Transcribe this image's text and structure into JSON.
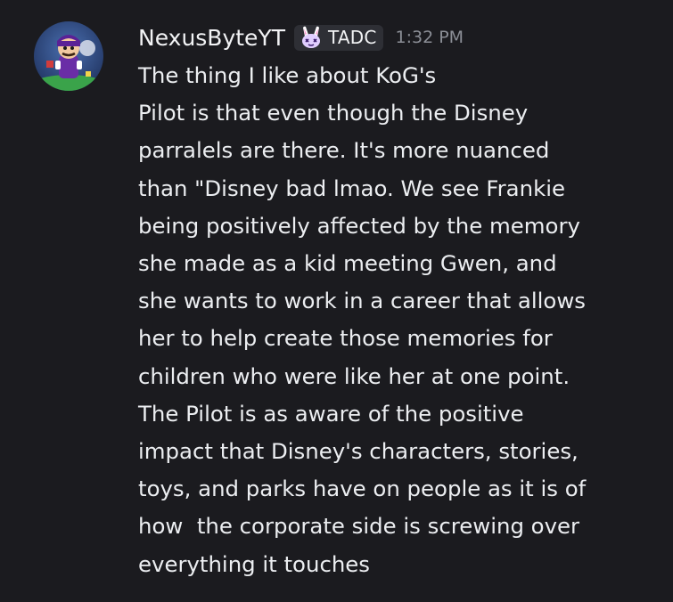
{
  "message": {
    "author": {
      "name": "NexusByteYT",
      "avatar_icon": "purple-character-avatar-icon"
    },
    "tag": {
      "icon": "bunny-icon",
      "label": "TADC",
      "icon_color": "#c9a6ff"
    },
    "timestamp": "1:32 PM",
    "lines": [
      "The thing I like about KoG's",
      "Pilot is that even though the Disney",
      "parralels are there. It's more nuanced",
      "than \"Disney bad lmao. We see Frankie",
      "being positively affected by the memory",
      "she made as a kid meeting Gwen, and",
      "she wants to work in a career that allows",
      "her to help create those memories for",
      "children who were like her at one point.",
      "The Pilot is as aware of the positive",
      "impact that Disney's characters, stories,",
      "toys, and parks have on people as it is of",
      "how  the corporate side is screwing over",
      "everything it touches"
    ]
  },
  "colors": {
    "background": "#1b1b1f",
    "text": "#eceef1",
    "timestamp": "#8b8e96",
    "tag_background": "#2e2f35"
  }
}
